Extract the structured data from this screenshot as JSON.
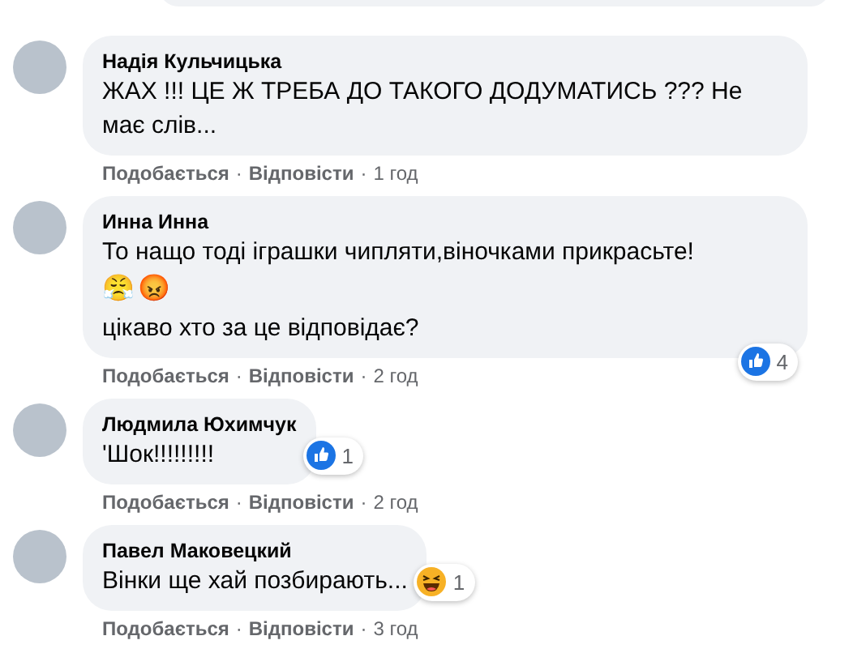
{
  "comments": [
    {
      "author": "Надія Кульчицька",
      "body": [
        {
          "kind": "text",
          "text": "ЖАХ !!! ЦЕ Ж ТРЕБА ДО ТАКОГО ДОДУМАТИСЬ ??? Не має слів..."
        }
      ],
      "like": "Подобається",
      "separator": "·",
      "reply": "Відповісти",
      "time": "1 год"
    },
    {
      "author": "Инна Инна",
      "body": [
        {
          "kind": "text",
          "text": "То нащо тоді іграшки чипляти,віночками прикрасьте!"
        },
        {
          "kind": "emoji",
          "emojis": [
            "😤",
            "😡"
          ]
        },
        {
          "kind": "text",
          "text": "цікаво хто за це відповідає?"
        }
      ],
      "reaction": {
        "kind": "like",
        "count": "4"
      },
      "like": "Подобається",
      "separator": "·",
      "reply": "Відповісти",
      "time": "2 год"
    },
    {
      "author": "Людмила Юхимчук",
      "body": [
        {
          "kind": "text",
          "text": "'Шок!!!!!!!!!"
        }
      ],
      "reaction": {
        "kind": "like",
        "count": "1"
      },
      "like": "Подобається",
      "separator": "·",
      "reply": "Відповісти",
      "time": "2 год"
    },
    {
      "author": "Павел Маковецкий",
      "body": [
        {
          "kind": "text",
          "text": "Вінки ще хай позбирають..."
        }
      ],
      "reaction": {
        "kind": "haha",
        "count": "1"
      },
      "like": "Подобається",
      "separator": "·",
      "reply": "Відповісти",
      "time": "3 год"
    }
  ]
}
